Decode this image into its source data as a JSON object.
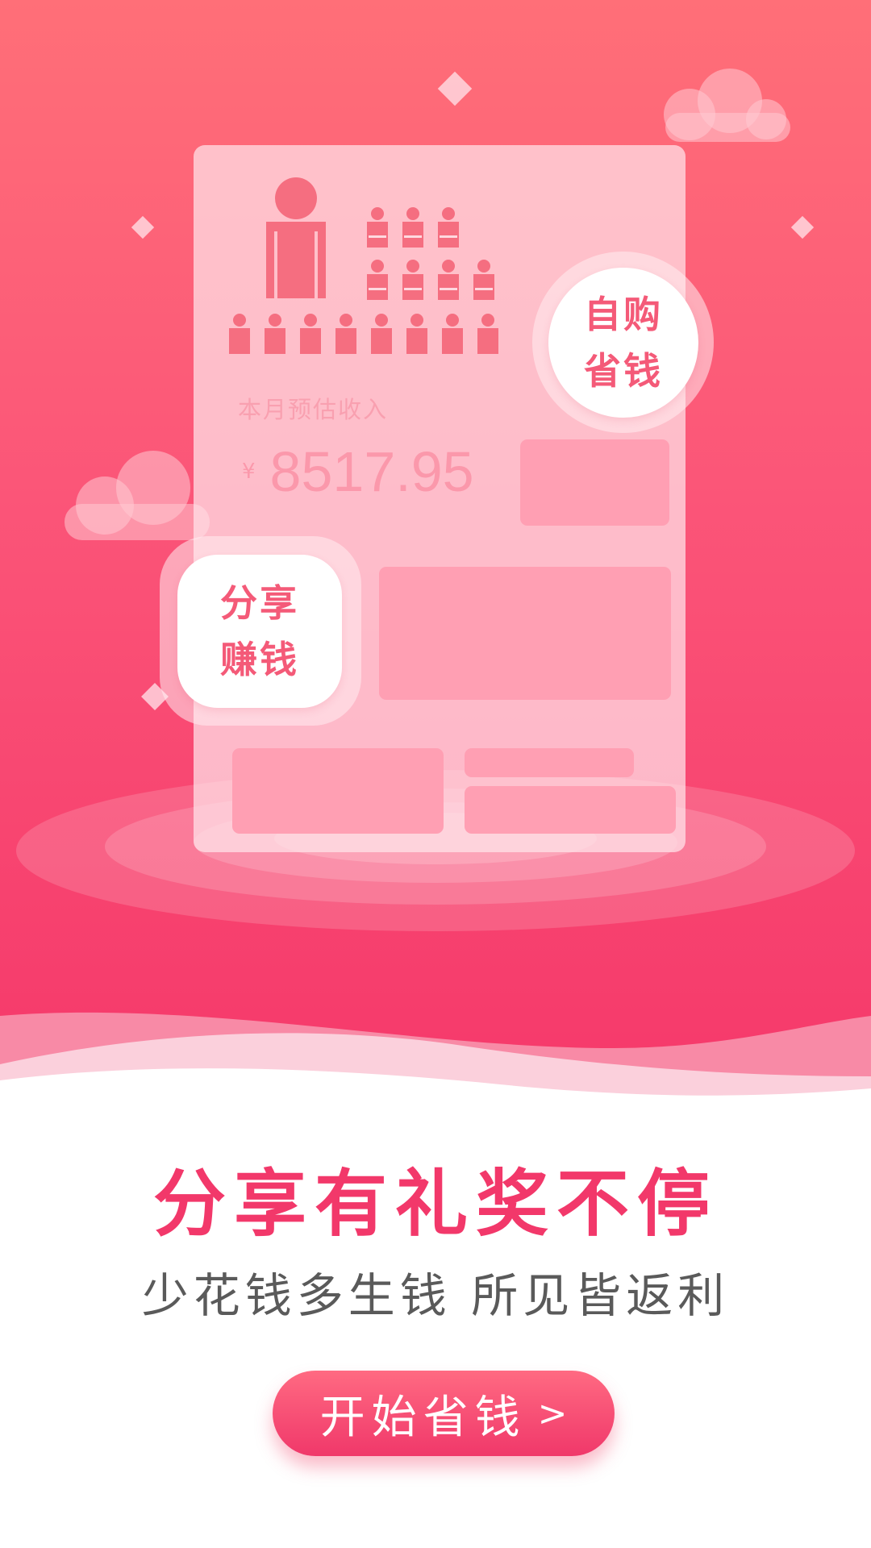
{
  "card": {
    "income_label": "本月预估收入",
    "currency": "¥",
    "income_value": "8517.95"
  },
  "badges": {
    "self_buy": [
      "自购",
      "省钱"
    ],
    "share_earn": [
      "分享",
      "赚钱"
    ]
  },
  "headline": "分享有礼奖不停",
  "subline": "少花钱多生钱 所见皆返利",
  "cta": {
    "label": "开始省钱",
    "chevron": ">"
  },
  "colors": {
    "brand": "#f2386a",
    "hero_top": "#ff6f78",
    "hero_bottom": "#f5386a",
    "subtext": "#5a5a5a"
  },
  "icons": [
    "people-group-icon",
    "cloud-icon",
    "sparkle-icon",
    "chevron-right-icon"
  ]
}
